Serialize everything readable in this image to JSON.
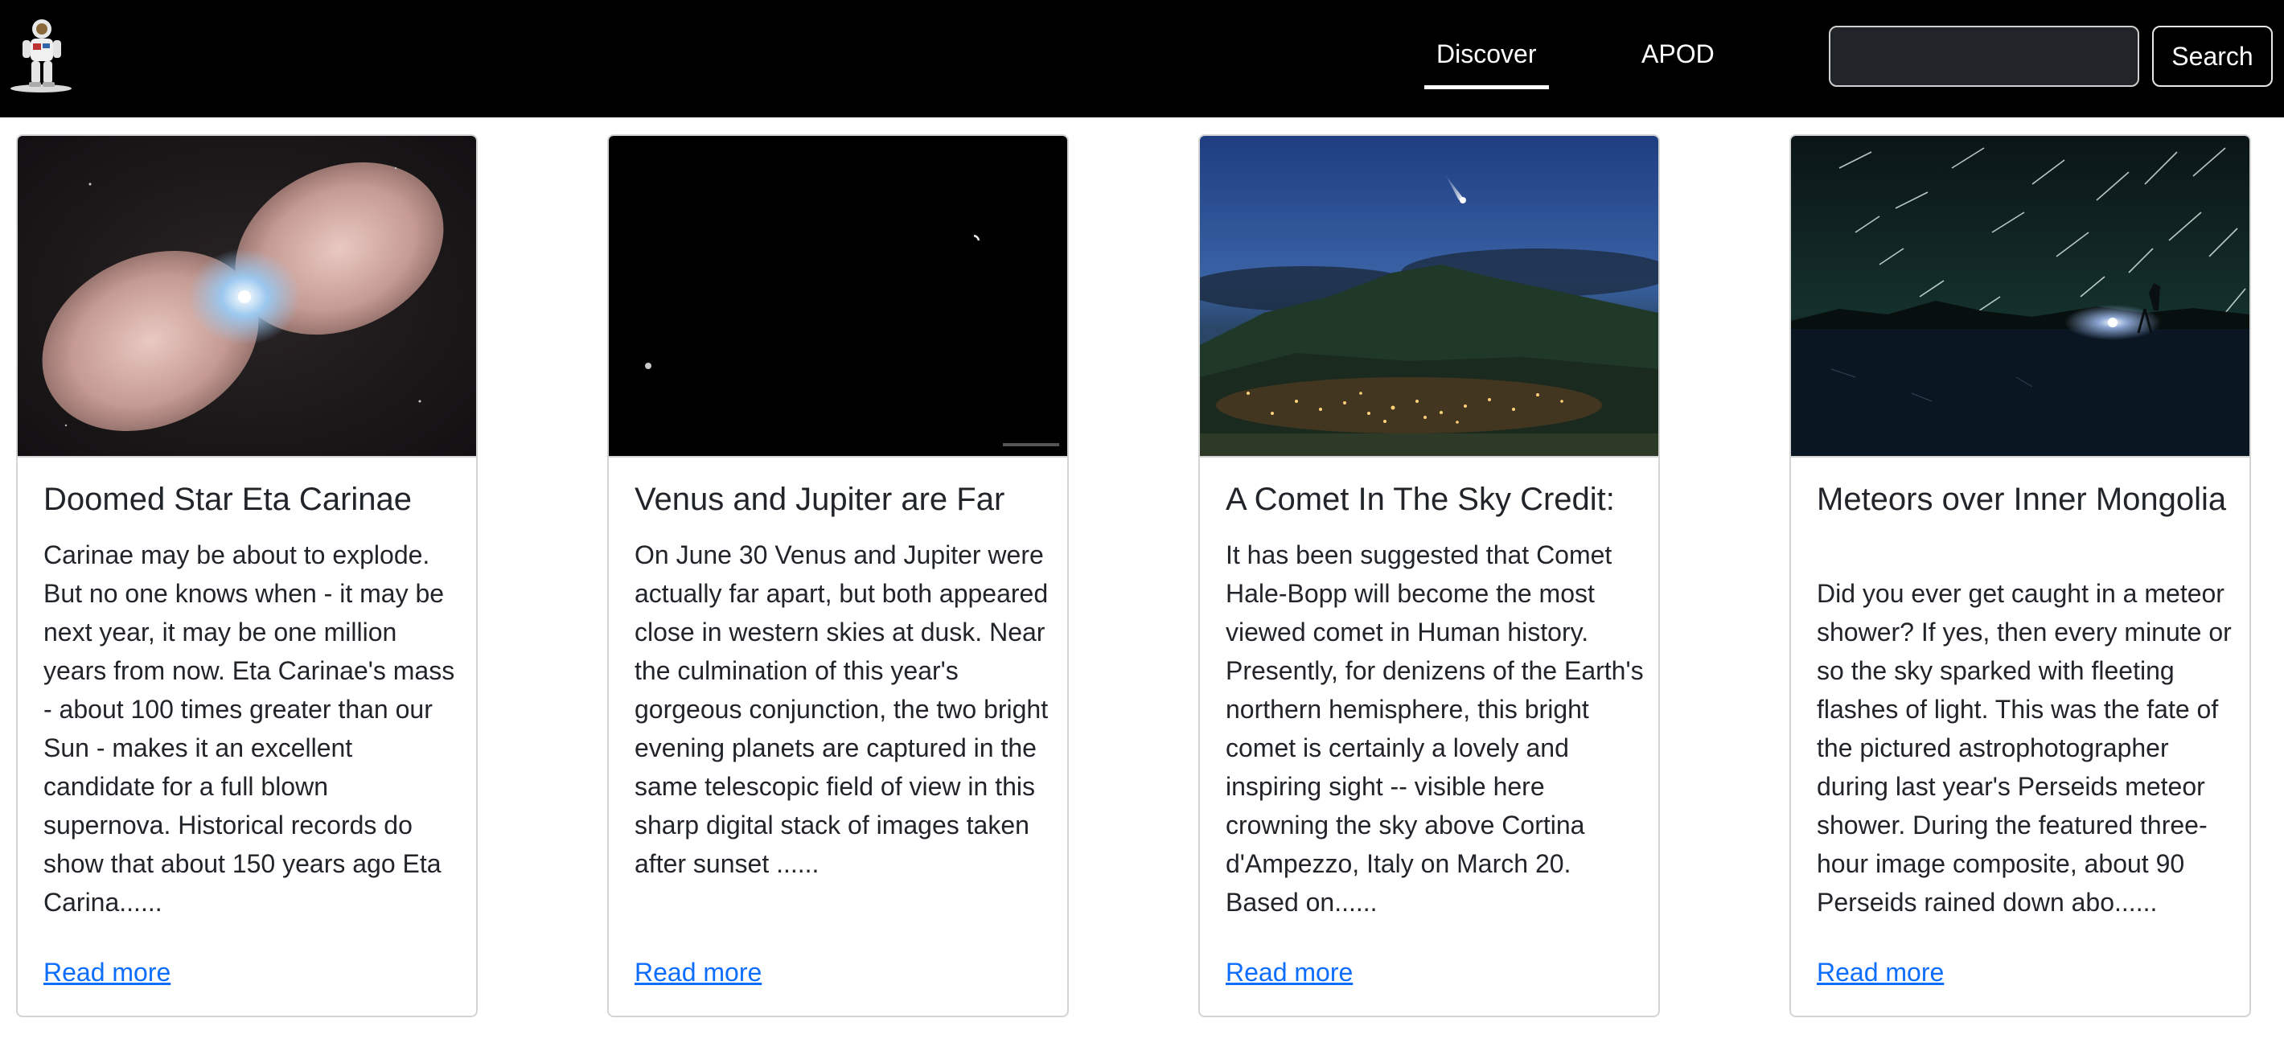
{
  "nav": {
    "links": [
      "Discover",
      "APOD"
    ],
    "search_placeholder": "",
    "search_button": "Search",
    "active_color": "#ffffff"
  },
  "cards": [
    {
      "title": "Doomed Star Eta Carinae",
      "text": "Carinae may be about to explode. But no one knows when - it may be next year, it may be one million years from now. Eta Carinae's mass - about 100 times greater than our Sun - makes it an excellent candidate for a full blown supernova. Historical records do show that about 150 years ago Eta Carina......",
      "link": "Read more",
      "image_icon": "nebula-image"
    },
    {
      "title": "Venus and Jupiter are Far",
      "text": "On June 30 Venus and Jupiter were actually far apart, but both appeared close in western skies at dusk. Near the culmination of this year's gorgeous conjunction, the two bright evening planets are captured in the same telescopic field of view in this sharp digital stack of images taken after sunset ......",
      "link": "Read more",
      "image_icon": "planets-image"
    },
    {
      "title": "A Comet In The Sky Credit:",
      "text": "It has been suggested that Comet Hale-Bopp will become the most viewed comet in Human history. Presently, for denizens of the Earth's northern hemisphere, this bright comet is certainly a lovely and inspiring sight -- visible here crowning the sky above Cortina d'Ampezzo, Italy on March 20. Based on......",
      "link": "Read more",
      "image_icon": "comet-image"
    },
    {
      "title": "Meteors over Inner Mongolia",
      "text": "Did you ever get caught in a meteor shower? If yes, then every minute or so the sky sparked with fleeting flashes of light. This was the fate of the pictured astrophotographer during last year's Perseids meteor shower. During the featured three-hour image composite, about 90 Perseids rained down abo......",
      "link": "Read more",
      "image_icon": "meteor-shower-image"
    }
  ],
  "colors": {
    "navbar": "#000000",
    "link": "#0d6efd",
    "text": "#212529",
    "border": "#d4d4d4"
  }
}
